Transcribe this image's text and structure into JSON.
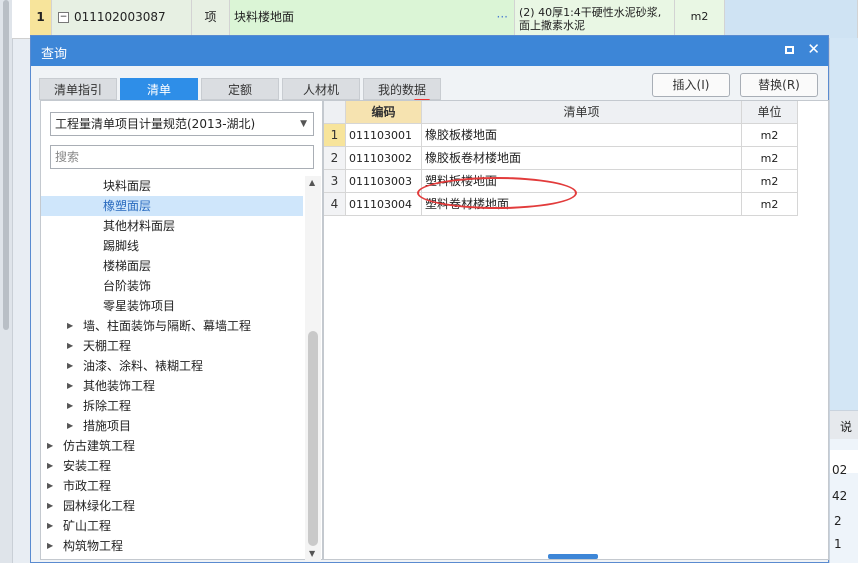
{
  "background": {
    "row": {
      "number": "1",
      "collapse_box": "−",
      "code": "011102003087",
      "kind": "项",
      "name": "块料楼地面",
      "ellipsis": "···",
      "desc_lines": [
        "(2) 40厚1:4干硬性水泥砂浆,",
        "面上撒素水泥"
      ],
      "unit": "m2"
    },
    "right_strip": [
      "说",
      "02",
      "42",
      "2",
      "1"
    ]
  },
  "dialog": {
    "title": "查询",
    "tabs": [
      {
        "label": "清单指引",
        "active": false
      },
      {
        "label": "清单",
        "active": true
      },
      {
        "label": "定额",
        "active": false
      },
      {
        "label": "人材机",
        "active": false
      },
      {
        "label": "我的数据",
        "active": false
      }
    ],
    "insert_button": "插入(I)",
    "replace_button": "替换(R)",
    "spec_select": "工程量清单项目计量规范(2013-湖北)",
    "search_placeholder": "搜索",
    "tree": [
      {
        "label": "块料面层",
        "level": 3,
        "expandable": false,
        "selected": false
      },
      {
        "label": "橡塑面层",
        "level": 3,
        "expandable": false,
        "selected": true
      },
      {
        "label": "其他材料面层",
        "level": 3,
        "expandable": false,
        "selected": false
      },
      {
        "label": "踢脚线",
        "level": 3,
        "expandable": false,
        "selected": false
      },
      {
        "label": "楼梯面层",
        "level": 3,
        "expandable": false,
        "selected": false
      },
      {
        "label": "台阶装饰",
        "level": 3,
        "expandable": false,
        "selected": false
      },
      {
        "label": "零星装饰项目",
        "level": 3,
        "expandable": false,
        "selected": false
      },
      {
        "label": "墙、柱面装饰与隔断、幕墙工程",
        "level": 2,
        "expandable": true,
        "selected": false
      },
      {
        "label": "天棚工程",
        "level": 2,
        "expandable": true,
        "selected": false
      },
      {
        "label": "油漆、涂料、裱糊工程",
        "level": 2,
        "expandable": true,
        "selected": false
      },
      {
        "label": "其他装饰工程",
        "level": 2,
        "expandable": true,
        "selected": false
      },
      {
        "label": "拆除工程",
        "level": 2,
        "expandable": true,
        "selected": false
      },
      {
        "label": "措施项目",
        "level": 2,
        "expandable": true,
        "selected": false
      },
      {
        "label": "仿古建筑工程",
        "level": 1,
        "expandable": true,
        "selected": false
      },
      {
        "label": "安装工程",
        "level": 1,
        "expandable": true,
        "selected": false
      },
      {
        "label": "市政工程",
        "level": 1,
        "expandable": true,
        "selected": false
      },
      {
        "label": "园林绿化工程",
        "level": 1,
        "expandable": true,
        "selected": false
      },
      {
        "label": "矿山工程",
        "level": 1,
        "expandable": true,
        "selected": false
      },
      {
        "label": "构筑物工程",
        "level": 1,
        "expandable": true,
        "selected": false
      }
    ],
    "table": {
      "headers": {
        "code": "编码",
        "name": "清单项",
        "unit": "单位"
      },
      "rows": [
        {
          "no": "1",
          "code": "011103001",
          "name": "橡胶板楼地面",
          "unit": "m2"
        },
        {
          "no": "2",
          "code": "011103002",
          "name": "橡胶板卷材楼地面",
          "unit": "m2"
        },
        {
          "no": "3",
          "code": "011103003",
          "name": "塑料板楼地面",
          "unit": "m2"
        },
        {
          "no": "4",
          "code": "011103004",
          "name": "塑料卷材楼地面",
          "unit": "m2"
        }
      ]
    }
  }
}
